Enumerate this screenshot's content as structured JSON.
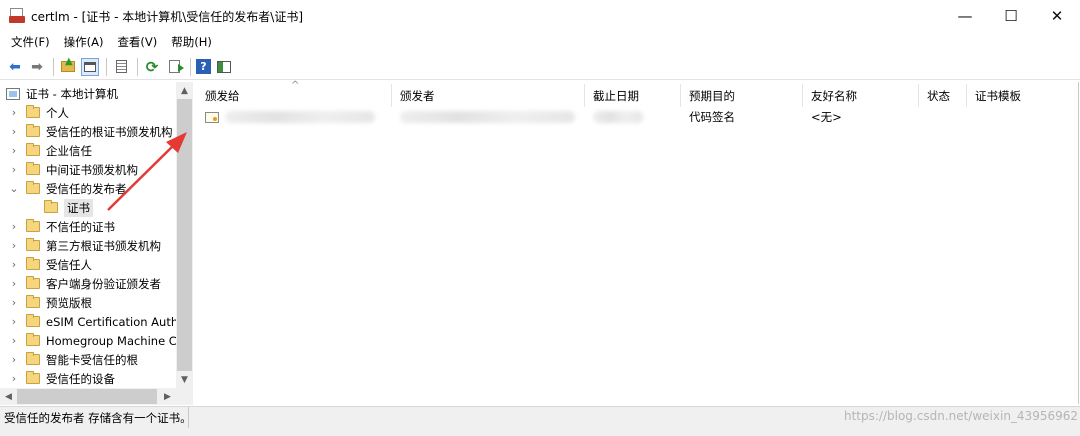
{
  "window": {
    "title": "certlm - [证书 - 本地计算机\\受信任的发布者\\证书]",
    "minimize": "—",
    "maximize": "☐",
    "close": "✕"
  },
  "menu": [
    "文件(F)",
    "操作(A)",
    "查看(V)",
    "帮助(H)"
  ],
  "tree": {
    "root": "证书 - 本地计算机",
    "items": [
      {
        "label": "个人",
        "expander": "›"
      },
      {
        "label": "受信任的根证书颁发机构",
        "expander": "›"
      },
      {
        "label": "企业信任",
        "expander": "›"
      },
      {
        "label": "中间证书颁发机构",
        "expander": "›"
      },
      {
        "label": "受信任的发布者",
        "expander": "⌄"
      },
      {
        "label": "证书",
        "expander": ""
      },
      {
        "label": "不信任的证书",
        "expander": "›"
      },
      {
        "label": "第三方根证书颁发机构",
        "expander": "›"
      },
      {
        "label": "受信任人",
        "expander": "›"
      },
      {
        "label": "客户端身份验证颁发者",
        "expander": "›"
      },
      {
        "label": "预览版根",
        "expander": "›"
      },
      {
        "label": "eSIM Certification Autho",
        "expander": "›"
      },
      {
        "label": "Homegroup Machine C",
        "expander": "›"
      },
      {
        "label": "智能卡受信任的根",
        "expander": "›"
      },
      {
        "label": "受信任的设备",
        "expander": "›"
      }
    ]
  },
  "columns": [
    "颁发给",
    "颁发者",
    "截止日期",
    "预期目的",
    "友好名称",
    "状态",
    "证书模板"
  ],
  "sort_indicator": "^",
  "rows": [
    {
      "issued_to": "",
      "issuer": "",
      "expiration": "",
      "purpose": "代码签名",
      "friendly_name": "<无>",
      "status": "",
      "template": ""
    }
  ],
  "status": {
    "text": "受信任的发布者 存储含有一个证书。"
  },
  "watermark": "https://blog.csdn.net/weixin_43956962",
  "accent_color": "#e53935"
}
